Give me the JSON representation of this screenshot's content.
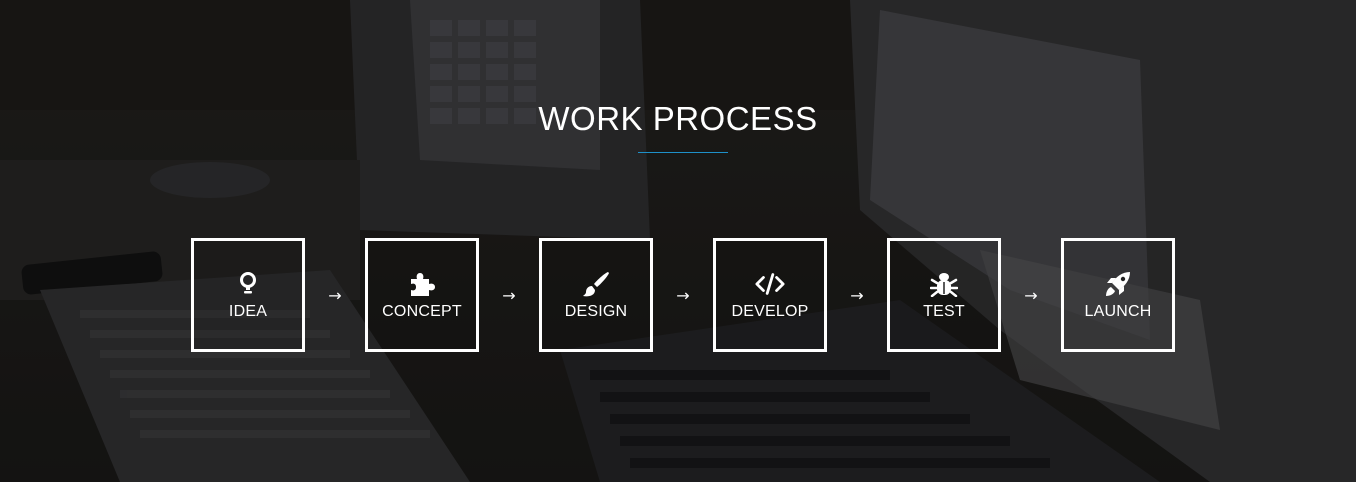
{
  "section": {
    "title": "WORK PROCESS",
    "accent_color": "#1e90c8"
  },
  "steps": [
    {
      "label": "IDEA",
      "icon": "lightbulb-icon"
    },
    {
      "label": "CONCEPT",
      "icon": "puzzle-icon"
    },
    {
      "label": "DESIGN",
      "icon": "brush-icon"
    },
    {
      "label": "DEVELOP",
      "icon": "code-icon"
    },
    {
      "label": "TEST",
      "icon": "bug-icon"
    },
    {
      "label": "LAUNCH",
      "icon": "rocket-icon"
    }
  ],
  "arrow_glyph": "→"
}
